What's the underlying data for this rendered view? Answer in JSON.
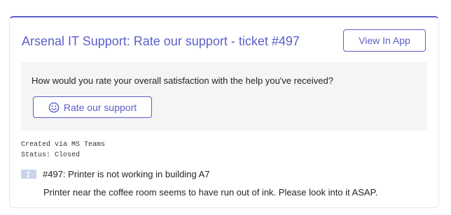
{
  "card": {
    "title": "Arsenal IT Support: Rate our support - ticket #497",
    "view_button_label": "View In App",
    "accent_color": "#5b5fc7"
  },
  "rating_panel": {
    "question": "How would you rate your overall satisfaction with the help you've received?",
    "rate_button_label": "Rate our support",
    "rate_button_icon": "smile-icon"
  },
  "meta": {
    "created": "Created via MS Teams",
    "status": "Status: Closed"
  },
  "ticket": {
    "icon": "ticket-icon",
    "title": "#497: Printer is not working in building A7",
    "description": "Printer near the coffee room seems to have run out of ink. Please look into it ASAP."
  }
}
